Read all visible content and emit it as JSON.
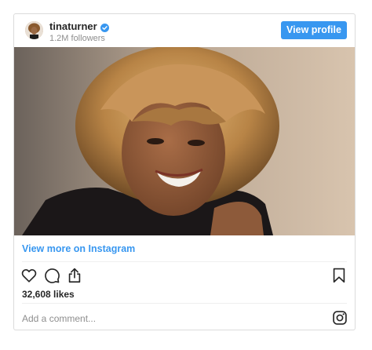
{
  "post": {
    "username": "tinaturner",
    "followers": "1.2M followers",
    "verified": true,
    "view_profile_label": "View profile",
    "view_more_label": "View more on Instagram",
    "likes": "32,608 likes",
    "comment_placeholder": "Add a comment..."
  },
  "icons": {
    "verified": "verified-badge-icon",
    "like": "heart-icon",
    "comment": "comment-bubble-icon",
    "share": "share-upload-icon",
    "save": "bookmark-icon",
    "brand": "instagram-logo-icon"
  },
  "colors": {
    "accent": "#3897f0",
    "text": "#262626",
    "muted": "#8e8e8e",
    "border": "#dbdbdb"
  }
}
